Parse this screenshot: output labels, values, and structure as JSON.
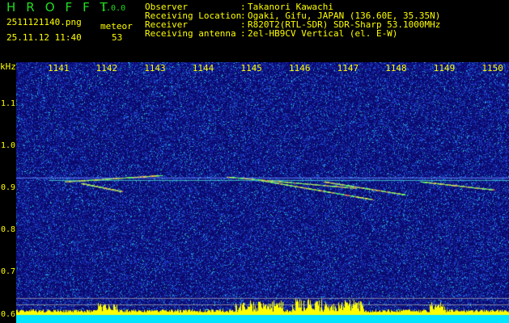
{
  "header": {
    "app_name": "HROFFT",
    "version": "1.0.0",
    "filename": "2511121140.png",
    "datetime": "25.11.12 11:40",
    "meteor_label": "meteor",
    "meteor_count": "53"
  },
  "info": [
    {
      "label": "Observer",
      "value": "Takanori Kawachi"
    },
    {
      "label": "Receiving Location",
      "value": "Ogaki, Gifu, JAPAN (136.60E, 35.35N)"
    },
    {
      "label": "Receiver",
      "value": "R820T2(RTL-SDR) SDR-Sharp 53.1000MHz"
    },
    {
      "label": "Receiving antenna",
      "value": "2el-HB9CV Vertical (el. E-W)"
    }
  ],
  "colors": {
    "text": "#ffff00",
    "logo": "#22dd22",
    "background": "#0a0a6e",
    "histogram_base": "#00e5ff"
  },
  "chart_data": {
    "type": "heatmap",
    "ylabel": "kHz",
    "x_ticks": [
      "1141",
      "1142",
      "1143",
      "1144",
      "1145",
      "1146",
      "1147",
      "1148",
      "1149",
      "1150"
    ],
    "y_ticks": [
      "1.1",
      "1.0",
      "0.9",
      "0.8",
      "0.7",
      "0.6"
    ],
    "ylim": [
      0.58,
      1.2
    ],
    "carrier_khz": 0.92
  }
}
